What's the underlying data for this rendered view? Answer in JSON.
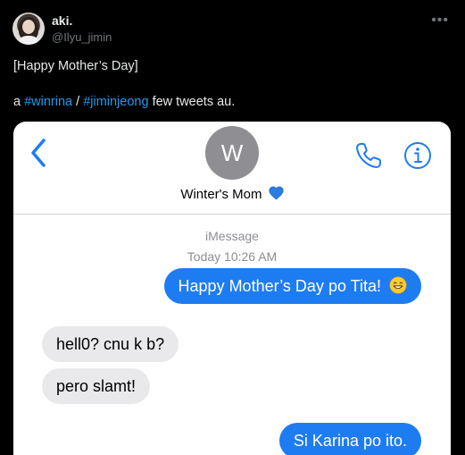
{
  "tweet": {
    "author": {
      "display_name": "aki.",
      "handle": "@Ilyu_jimin",
      "avatar_icon": "profile-photo"
    },
    "more_icon": "more-horizontal-icon",
    "text_line1": "[Happy Mother’s Day]",
    "text_line2": {
      "prefix": "a ",
      "hashtag1": "#winrina",
      "separator": " / ",
      "hashtag2": "#jiminjeong",
      "suffix": " few tweets au."
    },
    "link_color": "#1d9bf0"
  },
  "imessage": {
    "contact_initial": "W",
    "contact_name": "Winter's Mom",
    "contact_emoji": "blue-heart",
    "service": "iMessage",
    "timestamp": "Today 10:26 AM",
    "accent_color": "#1e7cf2",
    "messages": [
      {
        "direction": "sent",
        "text": "Happy Mother’s Day po Tita!",
        "emoji": "grinning-face"
      },
      {
        "direction": "received",
        "text": "hell0? cnu k b?"
      },
      {
        "direction": "received",
        "text": "pero slamt!"
      },
      {
        "direction": "sent",
        "text": "Si Karina po ito."
      }
    ]
  }
}
